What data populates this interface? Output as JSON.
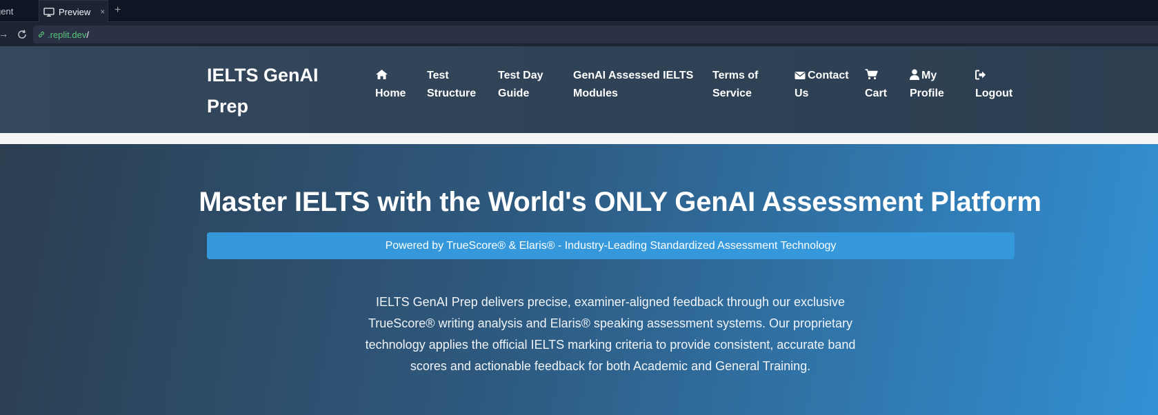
{
  "chrome": {
    "tabs": [
      {
        "label": "gent",
        "icon": "none",
        "active": false
      },
      {
        "label": "Preview",
        "icon": "monitor-icon",
        "active": true
      }
    ],
    "close_glyph": "×",
    "new_tab_glyph": "+",
    "url_host": ".replit.dev",
    "url_path": "/"
  },
  "header": {
    "brand_line1": "IELTS GenAI",
    "brand_line2": "Prep",
    "nav": [
      {
        "line1": "Home",
        "line2": "",
        "icon": "home-icon"
      },
      {
        "line1": "Test",
        "line2": "Structure",
        "icon": ""
      },
      {
        "line1": "Test Day",
        "line2": "Guide",
        "icon": ""
      },
      {
        "line1": "GenAI Assessed IELTS",
        "line2": "Modules",
        "icon": ""
      },
      {
        "line1": "Terms of",
        "line2": "Service",
        "icon": ""
      },
      {
        "line1": "Contact",
        "line2": "Us",
        "icon": "envelope-icon"
      },
      {
        "line1": "Cart",
        "line2": "",
        "icon": "cart-icon"
      },
      {
        "line1": "My",
        "line2": "Profile",
        "icon": "user-icon"
      },
      {
        "line1": "Logout",
        "line2": "",
        "icon": "logout-icon"
      }
    ]
  },
  "hero": {
    "title": "Master IELTS with the World's ONLY GenAI Assessment Platform",
    "powered_by": "Powered by TrueScore® & Elaris® - Industry-Leading Standardized Assessment Technology",
    "description": "IELTS GenAI Prep delivers precise, examiner-aligned feedback through our exclusive TrueScore® writing analysis and Elaris® speaking assessment systems. Our proprietary technology applies the official IELTS marking criteria to provide consistent, accurate band scores and actionable feedback for both Academic and General Training."
  },
  "colors": {
    "header_bg": "#2c3e50",
    "accent": "#3498db",
    "url_green": "#58c47a"
  }
}
